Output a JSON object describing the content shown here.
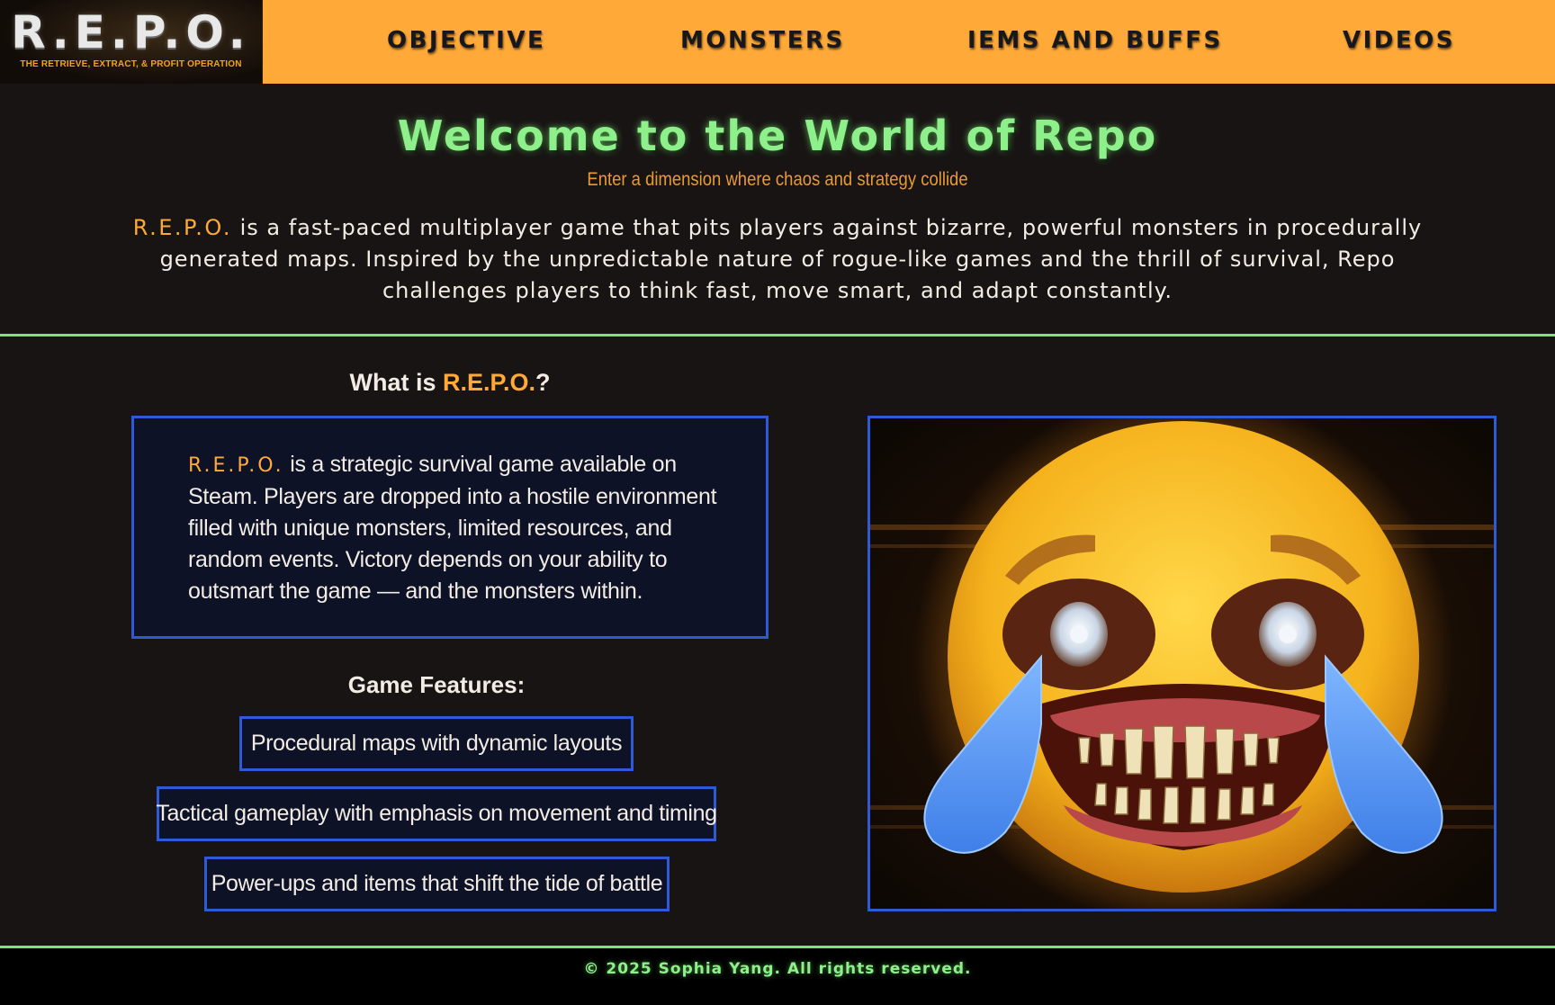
{
  "nav": {
    "logo_mark": "R.E.P.O.",
    "logo_tagline": "THE RETRIEVE, EXTRACT, & PROFIT OPERATION",
    "items": [
      {
        "label": "OBJECTIVE"
      },
      {
        "label": "MONSTERS"
      },
      {
        "label": "IEMS AND BUFFS"
      },
      {
        "label": "VIDEOS"
      }
    ]
  },
  "hero": {
    "title": "Welcome to the World of Repo",
    "subtitle": "Enter a dimension where chaos and strategy collide",
    "brand": "R.E.P.O.",
    "description": " is a fast-paced multiplayer game that pits players against bizarre, powerful monsters in procedurally generated maps. Inspired by the unpredictable nature of rogue-like games and the thrill of survival, Repo challenges players to think fast, move smart, and adapt constantly."
  },
  "about": {
    "heading_prefix": "What is ",
    "heading_brand": "R.E.P.O.",
    "heading_suffix": "?",
    "brand": "R.E.P.O.",
    "text": " is a strategic survival game available on Steam. Players are dropped into a hostile environment filled with unique monsters, limited resources, and random events. Victory depends on your ability to outsmart the game — and the monsters within."
  },
  "features": {
    "heading": "Game Features:",
    "items": [
      "Procedural maps with dynamic layouts",
      "Tactical gameplay with emphasis on movement and timing",
      "Power-ups and items that shift the tide of battle"
    ]
  },
  "image": {
    "subject": "distorted crying-laughing emoji monster"
  },
  "footer": {
    "text": "© 2025 Sophia Yang. All rights reserved."
  },
  "colors": {
    "nav_bg": "#ffa938",
    "accent_orange": "#ffa938",
    "accent_green": "#8ef08a",
    "box_border": "#2f5ad6",
    "page_bg": "#181414"
  }
}
